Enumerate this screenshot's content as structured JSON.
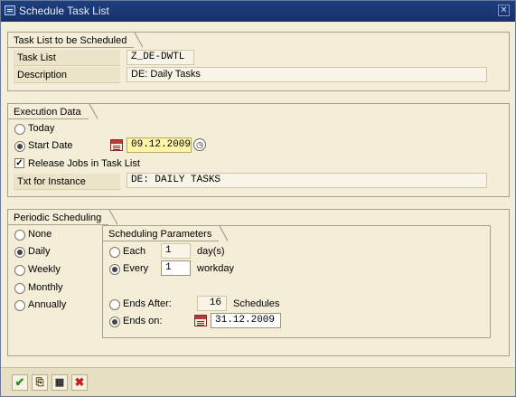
{
  "window": {
    "title": "Schedule Task List"
  },
  "task_list_section": {
    "title": "Task List to be Scheduled",
    "task_list_label": "Task List",
    "task_list_value": "Z_DE-DWTL",
    "description_label": "Description",
    "description_value": "DE: Daily Tasks"
  },
  "execution": {
    "title": "Execution Data",
    "today_label": "Today",
    "start_date_label": "Start Date",
    "start_date_value": "09.12.2009",
    "release_label": "Release Jobs in Task List",
    "release_checked": true,
    "instance_label": "Txt for Instance",
    "instance_value": "DE: DAILY TASKS",
    "selected": "start_date"
  },
  "periodic": {
    "title": "Periodic Scheduling",
    "options": [
      "None",
      "Daily",
      "Weekly",
      "Monthly",
      "Annually"
    ],
    "selected": "Daily",
    "params": {
      "title": "Scheduling Parameters",
      "each_label": "Each",
      "each_value": "1",
      "each_unit": "day(s)",
      "every_label": "Every",
      "every_value": "1",
      "every_unit": "workday",
      "ends_after_label": "Ends After:",
      "ends_after_value": "16",
      "ends_after_unit": "Schedules",
      "ends_on_label": "Ends on:",
      "ends_on_value": "31.12.2009",
      "interval_selected": "every",
      "end_selected": "ends_on"
    }
  },
  "toolbar": {
    "buttons": [
      "confirm-icon",
      "schedule-icon",
      "save-variant-icon",
      "cancel-icon"
    ]
  },
  "colors": {
    "title_bar": "#16316a",
    "panel_bg": "#f4eed8",
    "highlight_field": "#fff6a8",
    "cancel_red": "#c81e1e",
    "confirm_green": "#2c8a1e"
  }
}
